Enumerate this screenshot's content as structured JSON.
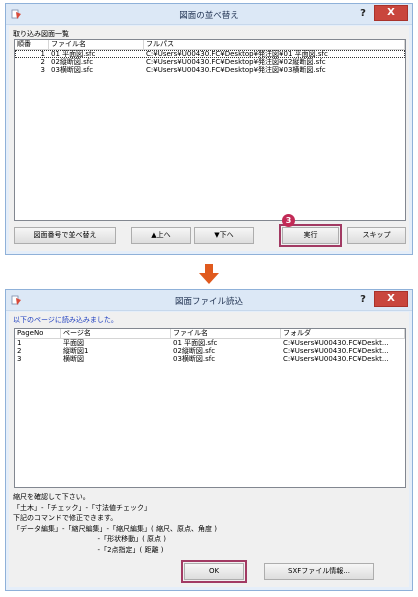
{
  "window1": {
    "title": "図面の並べ替え",
    "help_label": "?",
    "close_label": "X",
    "group_label": "取り込み図面一覧",
    "columns": [
      "順番",
      "ファイル名",
      "フルパス"
    ],
    "rows": [
      {
        "order": "1",
        "filename": "01 平面図.sfc",
        "path": "C:¥Users¥U00430.FC¥Desktop¥発注図¥01 平面図.sfc"
      },
      {
        "order": "2",
        "filename": "02縦断図.sfc",
        "path": "C:¥Users¥U00430.FC¥Desktop¥発注図¥02縦断図.sfc"
      },
      {
        "order": "3",
        "filename": "03横断図.sfc",
        "path": "C:¥Users¥U00430.FC¥Desktop¥発注図¥03横断図.sfc"
      }
    ],
    "buttons": {
      "sort_by_number": "図面番号で並べ替え",
      "up": "▲上へ",
      "down": "▼下へ",
      "execute": "実行",
      "skip": "スキップ"
    },
    "step_badge": "3"
  },
  "window2": {
    "title": "図面ファイル読込",
    "help_label": "?",
    "close_label": "X",
    "info": "以下のページに読み込みました。",
    "columns": [
      "PageNo",
      "ページ名",
      "ファイル名",
      "フォルダ"
    ],
    "rows": [
      {
        "page": "1",
        "name": "平面図",
        "file": "01 平面図.sfc",
        "folder": "C:¥Users¥U00430.FC¥Deskt..."
      },
      {
        "page": "2",
        "name": "縦断図1",
        "file": "02縦断図.sfc",
        "folder": "C:¥Users¥U00430.FC¥Deskt..."
      },
      {
        "page": "3",
        "name": "横断図",
        "file": "03横断図.sfc",
        "folder": "C:¥Users¥U00430.FC¥Deskt..."
      }
    ],
    "message_lines": [
      "縮尺を確認して下さい。",
      "「土木」-「チェック」-「寸法値チェック」",
      "下記のコマンドで修正できます。",
      "「データ編集」-「縮尺編集」-「縮尺編集」( 縮尺、原点、角度 )",
      "                                      -「形状移動」( 原点 )",
      "                                      -「2点指定」( 距離 )"
    ],
    "buttons": {
      "ok": "OK",
      "sxf_info": "SXFファイル情報..."
    }
  },
  "colors": {
    "title_bg": "#dce8f6",
    "close_red": "#c9463d",
    "highlight": "#a23a63",
    "badge": "#c22a56",
    "arrow": "#e05a1e",
    "info_blue": "#2040c0"
  }
}
